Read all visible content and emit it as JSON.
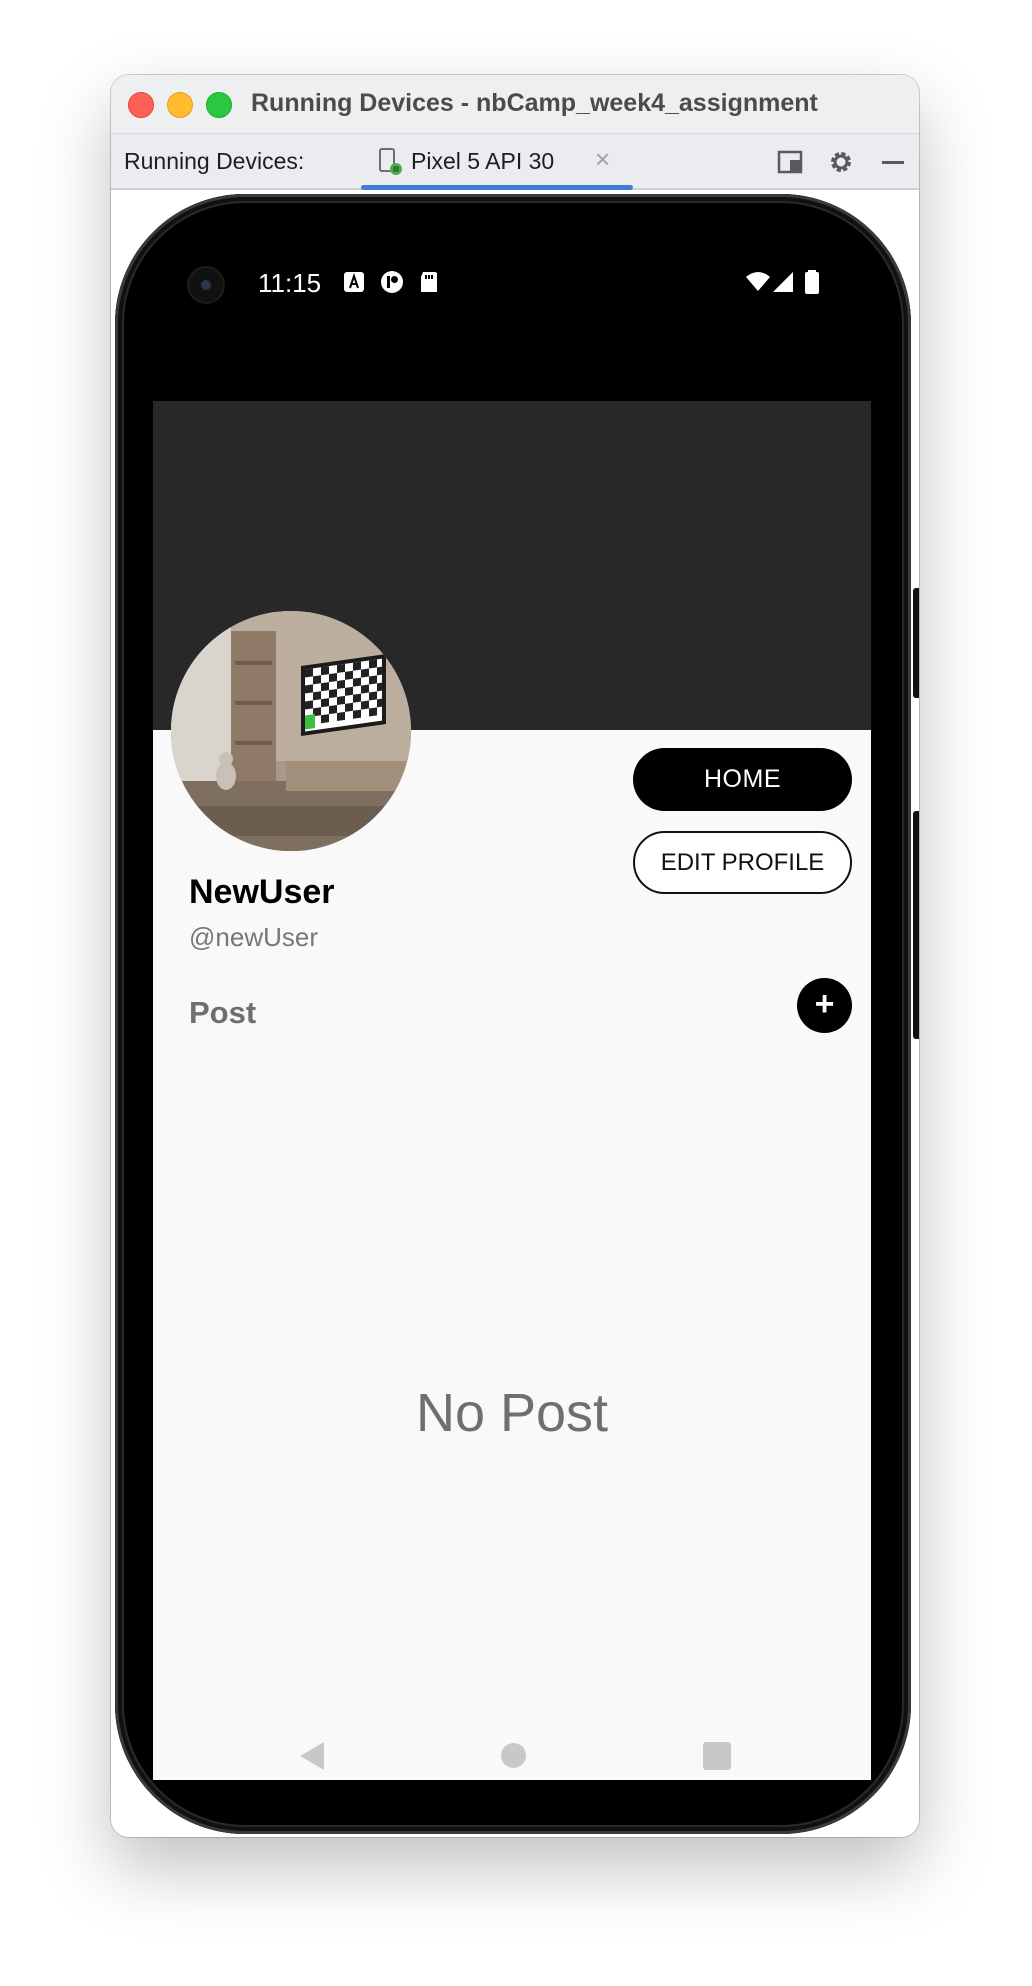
{
  "window": {
    "title": "Running Devices - nbCamp_week4_assignment"
  },
  "tabbar": {
    "label": "Running Devices:",
    "tab_label": "Pixel 5 API 30",
    "tab_close": "×"
  },
  "statusbar": {
    "time": "11:15"
  },
  "profile": {
    "home_label": "HOME",
    "edit_label": "EDIT PROFILE",
    "name": "NewUser",
    "handle": "@newUser",
    "post_label": "Post",
    "add_label": "+",
    "empty_text": "No Post"
  },
  "colors": {
    "banner": "#282828",
    "accent": "#3e7dd6",
    "screen_bg": "#f9f9f9"
  },
  "icons": {
    "statusbar_left": [
      "a-letter-icon",
      "media-icon",
      "sd-card-icon"
    ],
    "statusbar_right": [
      "wifi-icon",
      "signal-icon",
      "battery-icon"
    ],
    "toolbar": [
      "panel-icon",
      "gear-icon",
      "minimize-icon"
    ],
    "navbar": [
      "back-icon",
      "home-icon",
      "recents-icon"
    ]
  }
}
